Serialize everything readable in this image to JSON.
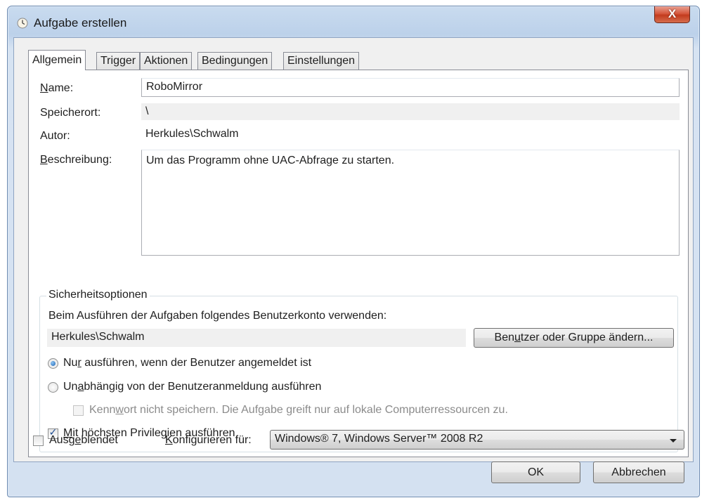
{
  "window": {
    "title": "Aufgabe erstellen",
    "close_symbol": "X"
  },
  "tabs": [
    {
      "label": "Allgemein",
      "active": true
    },
    {
      "label": "Trigger",
      "active": false
    },
    {
      "label": "Aktionen",
      "active": false
    },
    {
      "label": "Bedingungen",
      "active": false
    },
    {
      "label": "Einstellungen",
      "active": false
    }
  ],
  "general": {
    "name_label": "Name:",
    "name_value": "RoboMirror",
    "location_label": "Speicherort:",
    "location_value": "\\",
    "author_label": "Autor:",
    "author_value": "Herkules\\Schwalm",
    "description_label": "Beschreibung:",
    "description_value": "Um das Programm ohne UAC-Abfrage zu starten."
  },
  "security": {
    "group_title": "Sicherheitsoptionen",
    "account_prompt": "Beim Ausführen der Aufgaben folgendes Benutzerkonto verwenden:",
    "account_value": "Herkules\\Schwalm",
    "change_user_button": "Benutzer oder Gruppe ändern...",
    "radio_logged_on": "Nur ausführen, wenn der Benutzer angemeldet ist",
    "radio_logged_on_checked": true,
    "radio_independent": "Unabhängig von der Benutzeranmeldung ausführen",
    "radio_independent_checked": false,
    "no_password_checkbox": "Kennwort nicht speichern. Die Aufgabe greift nur auf lokale Computerressourcen zu.",
    "no_password_checked": false,
    "highest_privileges_checkbox": "Mit höchsten Privilegien ausführen",
    "highest_privileges_checked": true
  },
  "footer": {
    "hidden_checkbox": "Ausgeblendet",
    "hidden_checked": false,
    "configure_label": "Konfigurieren für:",
    "configure_value": "Windows® 7, Windows Server™ 2008 R2",
    "ok_button": "OK",
    "cancel_button": "Abbrechen"
  },
  "icons": {
    "title_icon": "clock-icon",
    "dropdown_icon": "chevron-down-icon",
    "check_icon": "checkmark-icon"
  }
}
